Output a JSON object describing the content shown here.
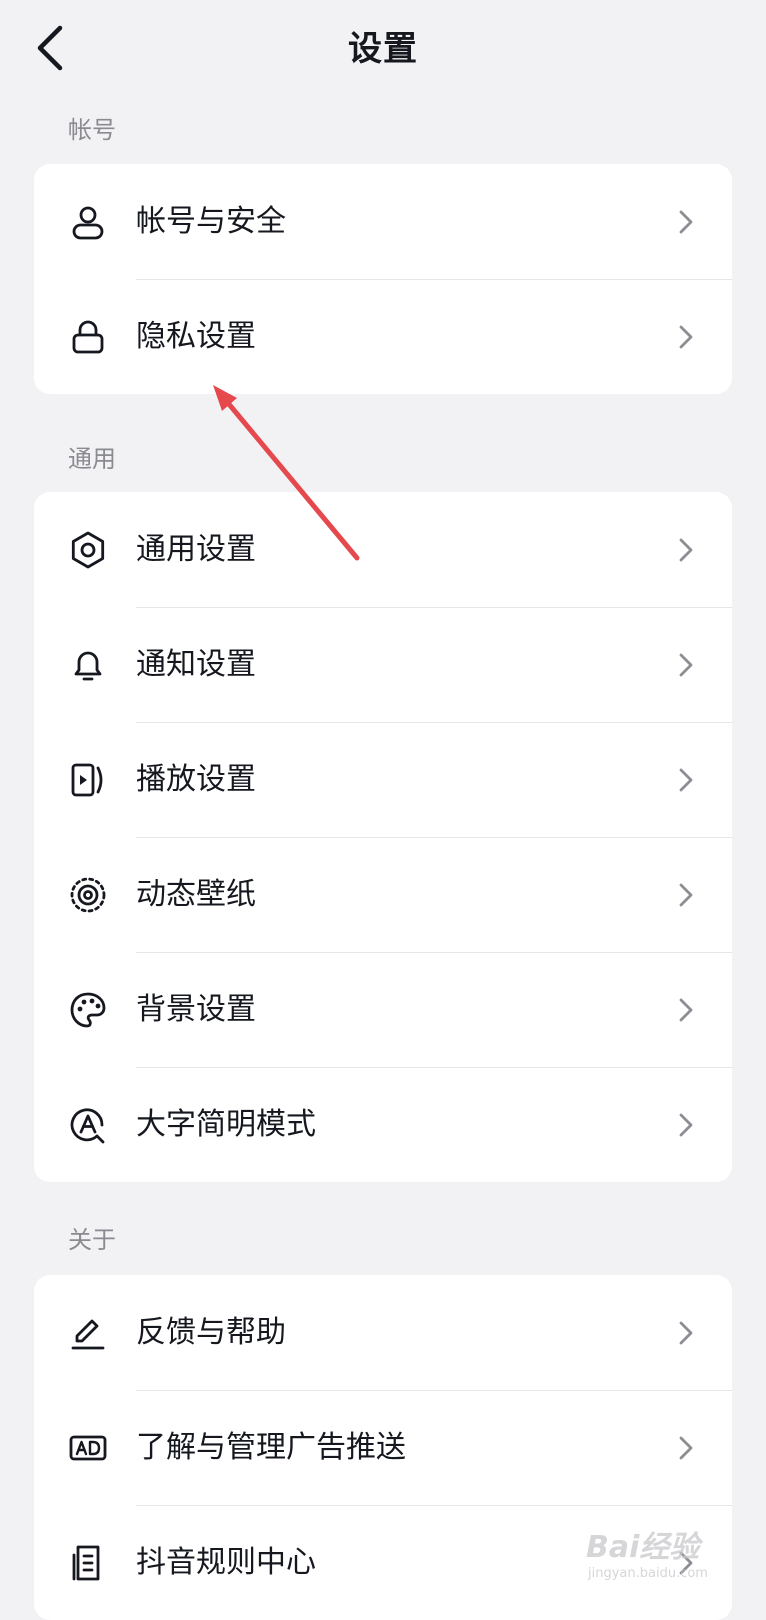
{
  "header": {
    "title": "设置",
    "back_icon": "chevron-left-icon"
  },
  "sections": [
    {
      "label": "帐号",
      "items": [
        {
          "label": "帐号与安全",
          "icon": "user-icon"
        },
        {
          "label": "隐私设置",
          "icon": "lock-icon"
        }
      ]
    },
    {
      "label": "通用",
      "items": [
        {
          "label": "通用设置",
          "icon": "gear-icon"
        },
        {
          "label": "通知设置",
          "icon": "bell-icon"
        },
        {
          "label": "播放设置",
          "icon": "video-play-icon"
        },
        {
          "label": "动态壁纸",
          "icon": "live-wallpaper-icon"
        },
        {
          "label": "背景设置",
          "icon": "palette-icon"
        },
        {
          "label": "大字简明模式",
          "icon": "large-text-icon"
        }
      ]
    },
    {
      "label": "关于",
      "items": [
        {
          "label": "反馈与帮助",
          "icon": "pencil-icon"
        },
        {
          "label": "了解与管理广告推送",
          "icon": "ad-icon"
        },
        {
          "label": "抖音规则中心",
          "icon": "document-icon"
        }
      ]
    }
  ],
  "chevron_icon": "chevron-right-icon",
  "annotation": {
    "type": "arrow",
    "color": "#e5484d"
  },
  "watermark": {
    "brand": "Bai经验",
    "url": "jingyan.baidu.com"
  },
  "colors": {
    "background": "#f2f2f4",
    "card": "#ffffff",
    "text": "#16181f",
    "section_label": "#8a8b91",
    "chevron": "#8d8e94",
    "divider": "#e6e6e9"
  }
}
